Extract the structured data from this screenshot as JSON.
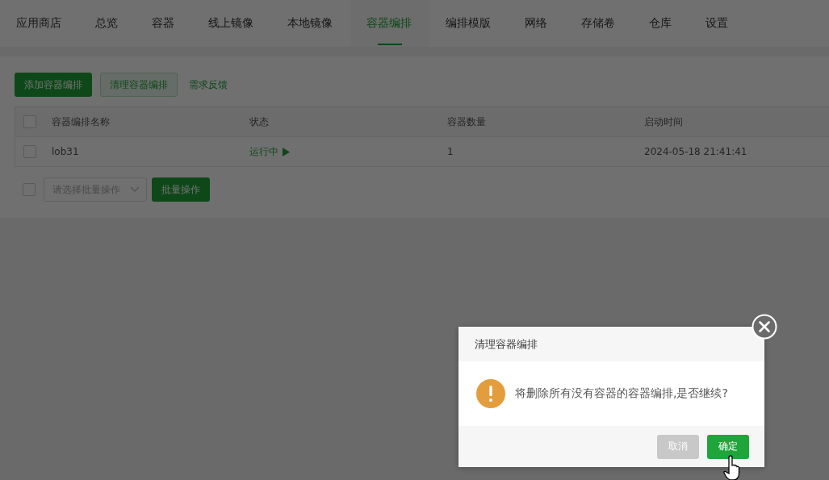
{
  "tabs": [
    {
      "label": "应用商店",
      "selected": false
    },
    {
      "label": "总览",
      "selected": false
    },
    {
      "label": "容器",
      "selected": false
    },
    {
      "label": "线上镜像",
      "selected": false
    },
    {
      "label": "本地镜像",
      "selected": false
    },
    {
      "label": "容器编排",
      "selected": true
    },
    {
      "label": "编排模版",
      "selected": false
    },
    {
      "label": "网络",
      "selected": false
    },
    {
      "label": "存储卷",
      "selected": false
    },
    {
      "label": "仓库",
      "selected": false
    },
    {
      "label": "设置",
      "selected": false
    }
  ],
  "toolbar": {
    "add_button": "添加容器编排",
    "clean_button": "清理容器编排",
    "feedback_link": "需求反馈"
  },
  "table": {
    "select_all_checked": false,
    "columns": [
      "容器编排名称",
      "状态",
      "容器数量",
      "启动时间"
    ],
    "rows": [
      {
        "checked": false,
        "name": "lob31",
        "status": "运行中",
        "running": true,
        "count": "1",
        "started": "2024-05-18 21:41:41"
      }
    ]
  },
  "batch": {
    "checked": false,
    "placeholder": "请选择批量操作",
    "button": "批量操作"
  },
  "dialog": {
    "title": "清理容器编排",
    "message": "将删除所有没有容器的容器编排,是否继续?",
    "cancel": "取消",
    "confirm": "确定"
  }
}
